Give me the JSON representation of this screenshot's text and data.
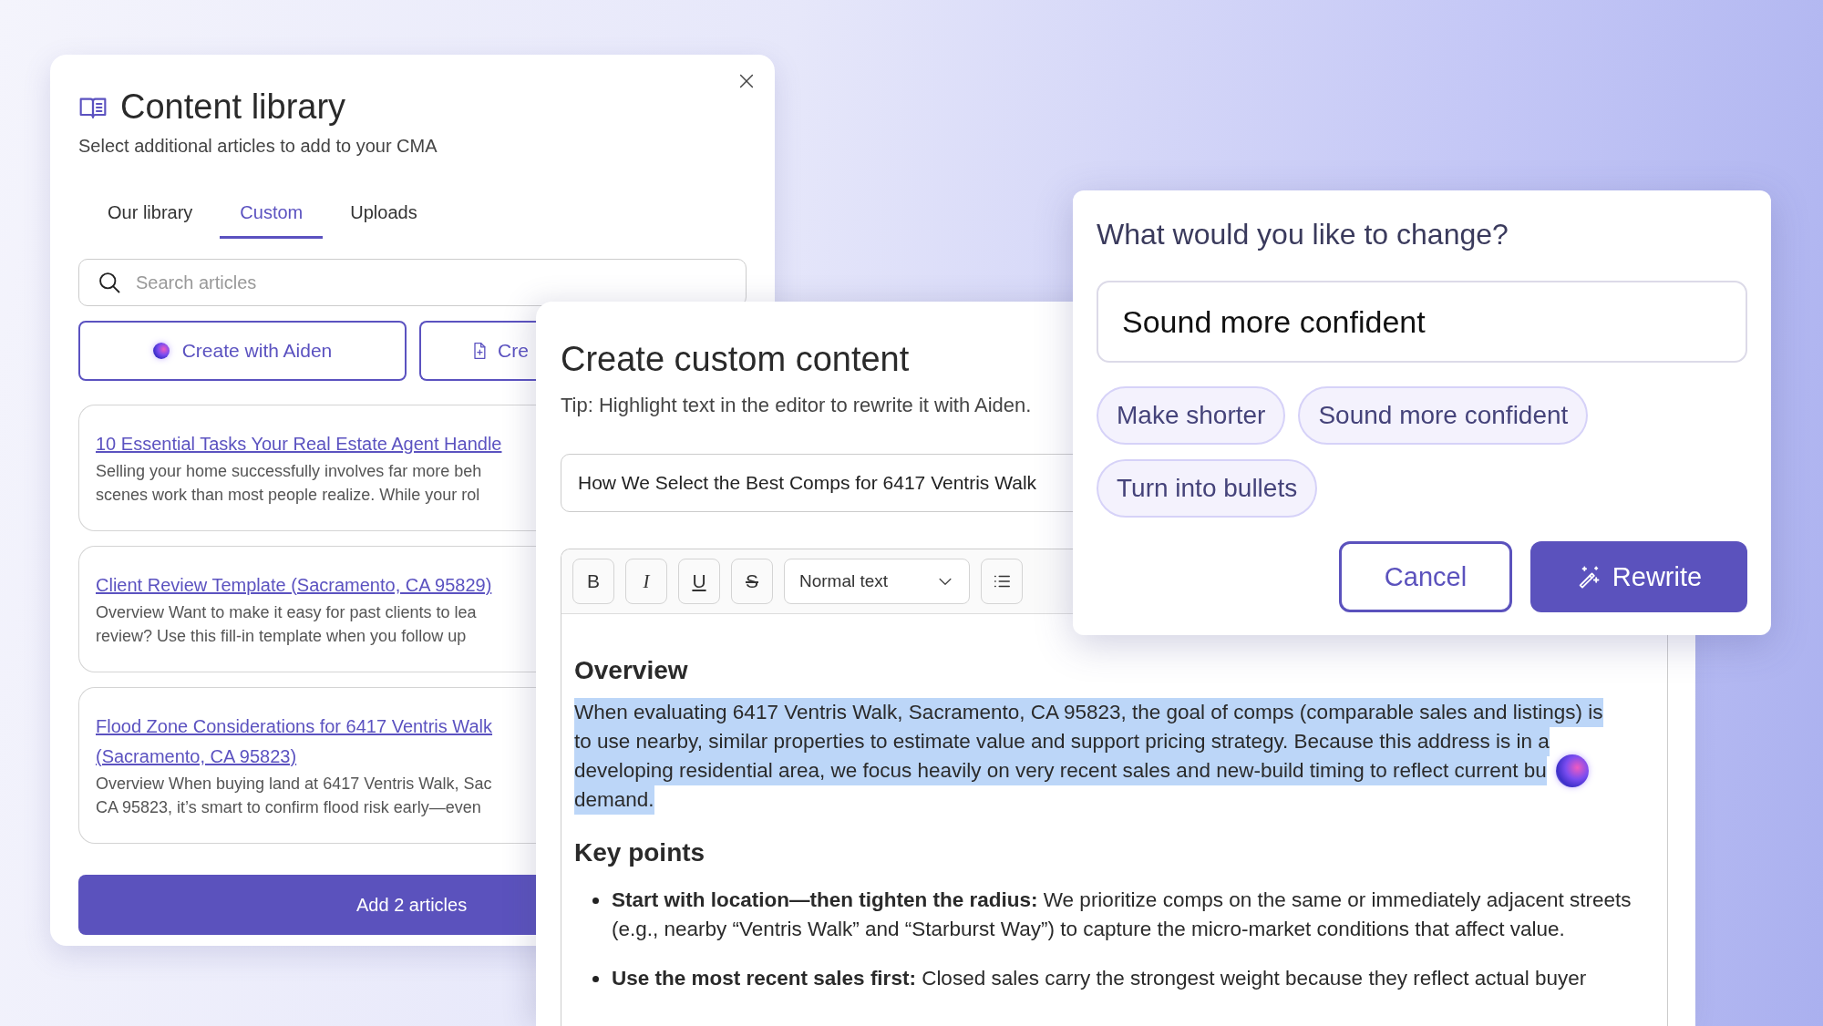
{
  "content_library": {
    "title": "Content library",
    "subtitle": "Select additional articles to add to your CMA",
    "tabs": [
      {
        "label": "Our library",
        "selected": false
      },
      {
        "label": "Custom",
        "selected": true
      },
      {
        "label": "Uploads",
        "selected": false
      }
    ],
    "search": {
      "placeholder": "Search articles"
    },
    "actions": [
      {
        "kind": "aiden",
        "label": "Create with Aiden"
      },
      {
        "kind": "file",
        "label": "Cre"
      }
    ],
    "articles": [
      {
        "title_lines": [
          "10 Essential Tasks Your Real Estate Agent Handle"
        ],
        "excerpt_lines": [
          "Selling your home successfully involves far more beh",
          "scenes work than most people realize. While your rol"
        ]
      },
      {
        "title_lines": [
          "Client Review Template (Sacramento, CA 95829)"
        ],
        "excerpt_lines": [
          "Overview Want to make it easy for past clients to lea",
          "review? Use this fill-in template when you follow up"
        ]
      },
      {
        "title_lines": [
          "Flood Zone Considerations for 6417 Ventris Walk",
          "(Sacramento, CA 95823)"
        ],
        "excerpt_lines": [
          "Overview When buying land at 6417 Ventris Walk, Sac",
          "CA 95823, it’s smart to confirm flood risk early—even"
        ]
      }
    ],
    "add_button": "Add 2 articles"
  },
  "editor": {
    "title": "Create custom content",
    "tip": "Tip: Highlight text in the editor to rewrite it with Aiden.",
    "title_field": {
      "value": "How We Select the Best Comps for 6417 Ventris Walk"
    },
    "toolbar": [
      {
        "kind": "bold",
        "label": "B"
      },
      {
        "kind": "italic",
        "label": "I"
      },
      {
        "kind": "underline",
        "label": "U"
      },
      {
        "kind": "strike",
        "label": "S"
      },
      {
        "kind": "select",
        "label": "Normal text"
      },
      {
        "kind": "list"
      }
    ],
    "overview_heading": "Overview",
    "paragraph": {
      "highlighted": true,
      "lines": [
        "When evaluating 6417 Ventris Walk, Sacramento, CA 95823, the goal of comps (comparable sales and listings) is",
        "to use nearby, similar properties to estimate value and support pricing strategy. Because this address is in a",
        "developing residential area, we focus heavily on very recent sales and new-build timing to reflect current bu",
        "demand."
      ]
    },
    "key_points_heading": "Key points",
    "bullets": [
      "**Start with location—then tighten the radius:** We prioritize comps on the same or immediately adjacent streets (e.g., nearby “Ventris Walk” and “Starburst Way”) to capture the micro-market conditions that affect value.",
      "**Use the most recent sales first:** Closed sales carry the strongest weight because they reflect actual buyer"
    ]
  },
  "rewrite_popup": {
    "title": "What would you like to change?",
    "input": {
      "value": "Sound more confident"
    },
    "suggestions": [
      "Make shorter",
      "Sound more confident",
      "Turn into bullets"
    ],
    "cancel": "Cancel",
    "rewrite": "Rewrite"
  }
}
